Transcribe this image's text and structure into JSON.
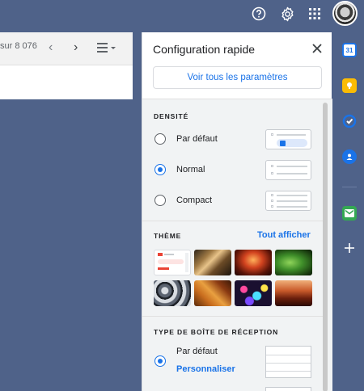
{
  "colors": {
    "accent": "#1a73e8",
    "background": "#4f6289",
    "panel_bg": "#f1f3f4"
  },
  "topbar": {
    "icons": [
      "help-icon",
      "settings-icon",
      "apps-grid-icon",
      "account-avatar"
    ]
  },
  "mail_toolbar": {
    "count_text": "sur 8 076",
    "prev_icon": "chevron-left-icon",
    "next_icon": "chevron-right-icon",
    "view_icon": "split-view-icon"
  },
  "side_rail": {
    "icons": [
      "calendar-icon",
      "keep-icon",
      "tasks-icon",
      "contacts-icon",
      "addon-icon",
      "plus-icon"
    ]
  },
  "quick_settings": {
    "title": "Configuration rapide",
    "close_icon": "close-icon",
    "all_settings_label": "Voir tous les paramètres",
    "density": {
      "title": "DENSITÉ",
      "options": [
        {
          "label": "Par défaut",
          "checked": false
        },
        {
          "label": "Normal",
          "checked": true
        },
        {
          "label": "Compact",
          "checked": false
        }
      ]
    },
    "theme": {
      "title": "THÈME",
      "show_all_label": "Tout afficher",
      "tiles": [
        "gmail-default-theme",
        "chess-theme",
        "canyon-theme",
        "leaf-theme",
        "pipes-theme",
        "autumn-leaves-theme",
        "bubbles-theme",
        "desert-theme"
      ]
    },
    "inbox_type": {
      "title": "TYPE DE BOÎTE DE RÉCEPTION",
      "options": [
        {
          "label": "Par défaut",
          "checked": true,
          "sub_link": "Personnaliser"
        }
      ]
    }
  }
}
